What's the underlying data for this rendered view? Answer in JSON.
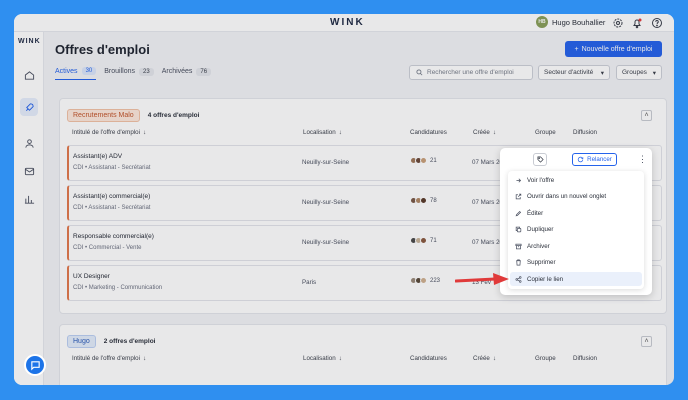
{
  "brand": "WINK",
  "user": {
    "initials": "HB",
    "name": "Hugo Bouhallier"
  },
  "page_title": "Offres d'emploi",
  "new_button": "Nouvelle offre d'emploi",
  "tabs": [
    {
      "label": "Actives",
      "count": "30"
    },
    {
      "label": "Brouillons",
      "count": "23"
    },
    {
      "label": "Archivées",
      "count": "76"
    }
  ],
  "search_placeholder": "Rechercher une offre d'emploi",
  "filters": {
    "sector": "Secteur d'activité",
    "groups": "Groupes"
  },
  "columns": {
    "title": "Intitulé de l'offre d'emploi",
    "location": "Localisation",
    "candidates": "Candidatures",
    "created": "Créée",
    "group": "Groupe",
    "diffusion": "Diffusion"
  },
  "group1": {
    "name": "Recrutements Malo",
    "count": "4 offres d'emploi",
    "rows": [
      {
        "title": "Assistant(e) ADV",
        "sub": "CDI • Assistanat - Secrétariat",
        "location": "Neuilly-sur-Seine",
        "candidates": "21",
        "date": "07 Mars 2024"
      },
      {
        "title": "Assistant(e) commercial(e)",
        "sub": "CDI • Assistanat - Secrétariat",
        "location": "Neuilly-sur-Seine",
        "candidates": "78",
        "date": "07 Mars 2024"
      },
      {
        "title": "Responsable commercial(e)",
        "sub": "CDI • Commercial - Vente",
        "location": "Neuilly-sur-Seine",
        "candidates": "71",
        "date": "07 Mars 2024"
      },
      {
        "title": "UX Designer",
        "sub": "CDI • Marketing - Communication",
        "location": "Paris",
        "candidates": "223",
        "date": "13 Fév"
      }
    ]
  },
  "group2": {
    "name": "Hugo",
    "count": "2 offres d'emploi"
  },
  "popup": {
    "relancer": "Relancer",
    "menu": [
      "Voir l'offre",
      "Ouvrir dans un nouvel onglet",
      "Éditer",
      "Dupliquer",
      "Archiver",
      "Supprimer",
      "Copier le lien"
    ]
  },
  "colors": {
    "accent": "#2563eb",
    "background": "#2f8ff0",
    "row_border": "#e2794c",
    "arrow": "#e03a3a"
  },
  "icons": [
    "home-icon",
    "rocket-icon",
    "person-icon",
    "mail-icon",
    "chart-icon",
    "gear-icon",
    "bell-icon",
    "help-icon",
    "tag-icon",
    "refresh-icon",
    "kebab-icon",
    "chat-icon"
  ]
}
